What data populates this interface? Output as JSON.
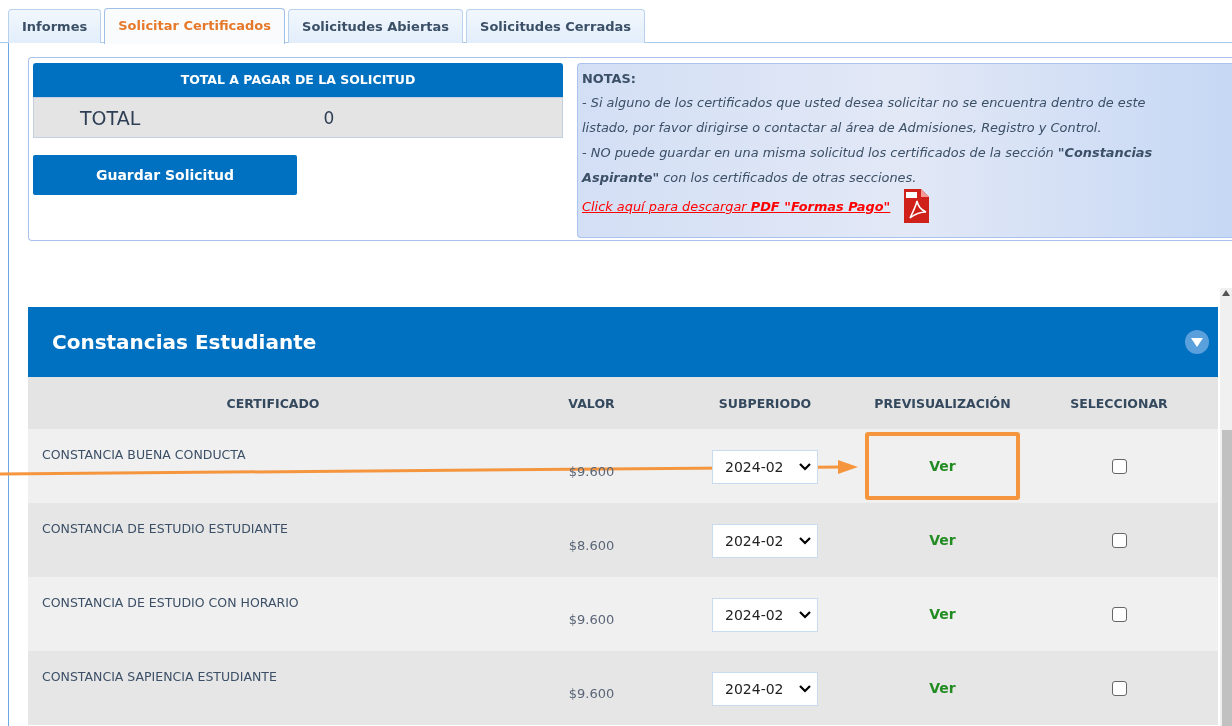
{
  "tabs": [
    {
      "label": "Informes",
      "selected": false
    },
    {
      "label": "Solicitar Certificados",
      "selected": true
    },
    {
      "label": "Solicitudes Abiertas",
      "selected": false
    },
    {
      "label": "Solicitudes Cerradas",
      "selected": false
    }
  ],
  "total_box": {
    "title": "TOTAL A PAGAR DE LA SOLICITUD",
    "label": "TOTAL",
    "value": "0"
  },
  "save_button": "Guardar Solicitud",
  "notes": {
    "title": "NOTAS:",
    "lines": [
      "- Si alguno de los certificados que usted desea solicitar no se encuentra dentro de este listado, por favor dirigirse o contactar al área de Admisiones, Registro y Control.",
      "- NO puede guardar en una misma solicitud los certificados de la sección **\"Constancias Aspirante\"** con los certificados de otras secciones."
    ],
    "link": "Click aquí para descargar **PDF \"Formas Pago\"**"
  },
  "section": {
    "title": "Constancias Estudiante",
    "expanded": true,
    "columns": [
      "CERTIFICADO",
      "VALOR",
      "SUBPERIODO",
      "PREVISUALIZACIÓN",
      "SELECCIONAR"
    ],
    "rows": [
      {
        "name": "CONSTANCIA BUENA CONDUCTA",
        "value": "$9.600",
        "subperiod": "2024-02",
        "preview": "Ver",
        "checked": false,
        "highlighted": true
      },
      {
        "name": "CONSTANCIA DE ESTUDIO ESTUDIANTE",
        "value": "$8.600",
        "subperiod": "2024-02",
        "preview": "Ver",
        "checked": false,
        "highlighted": false
      },
      {
        "name": "CONSTANCIA DE ESTUDIO CON HORARIO",
        "value": "$9.600",
        "subperiod": "2024-02",
        "preview": "Ver",
        "checked": false,
        "highlighted": false
      },
      {
        "name": "CONSTANCIA SAPIENCIA ESTUDIANTE",
        "value": "$9.600",
        "subperiod": "2024-02",
        "preview": "Ver",
        "checked": false,
        "highlighted": false
      }
    ]
  }
}
